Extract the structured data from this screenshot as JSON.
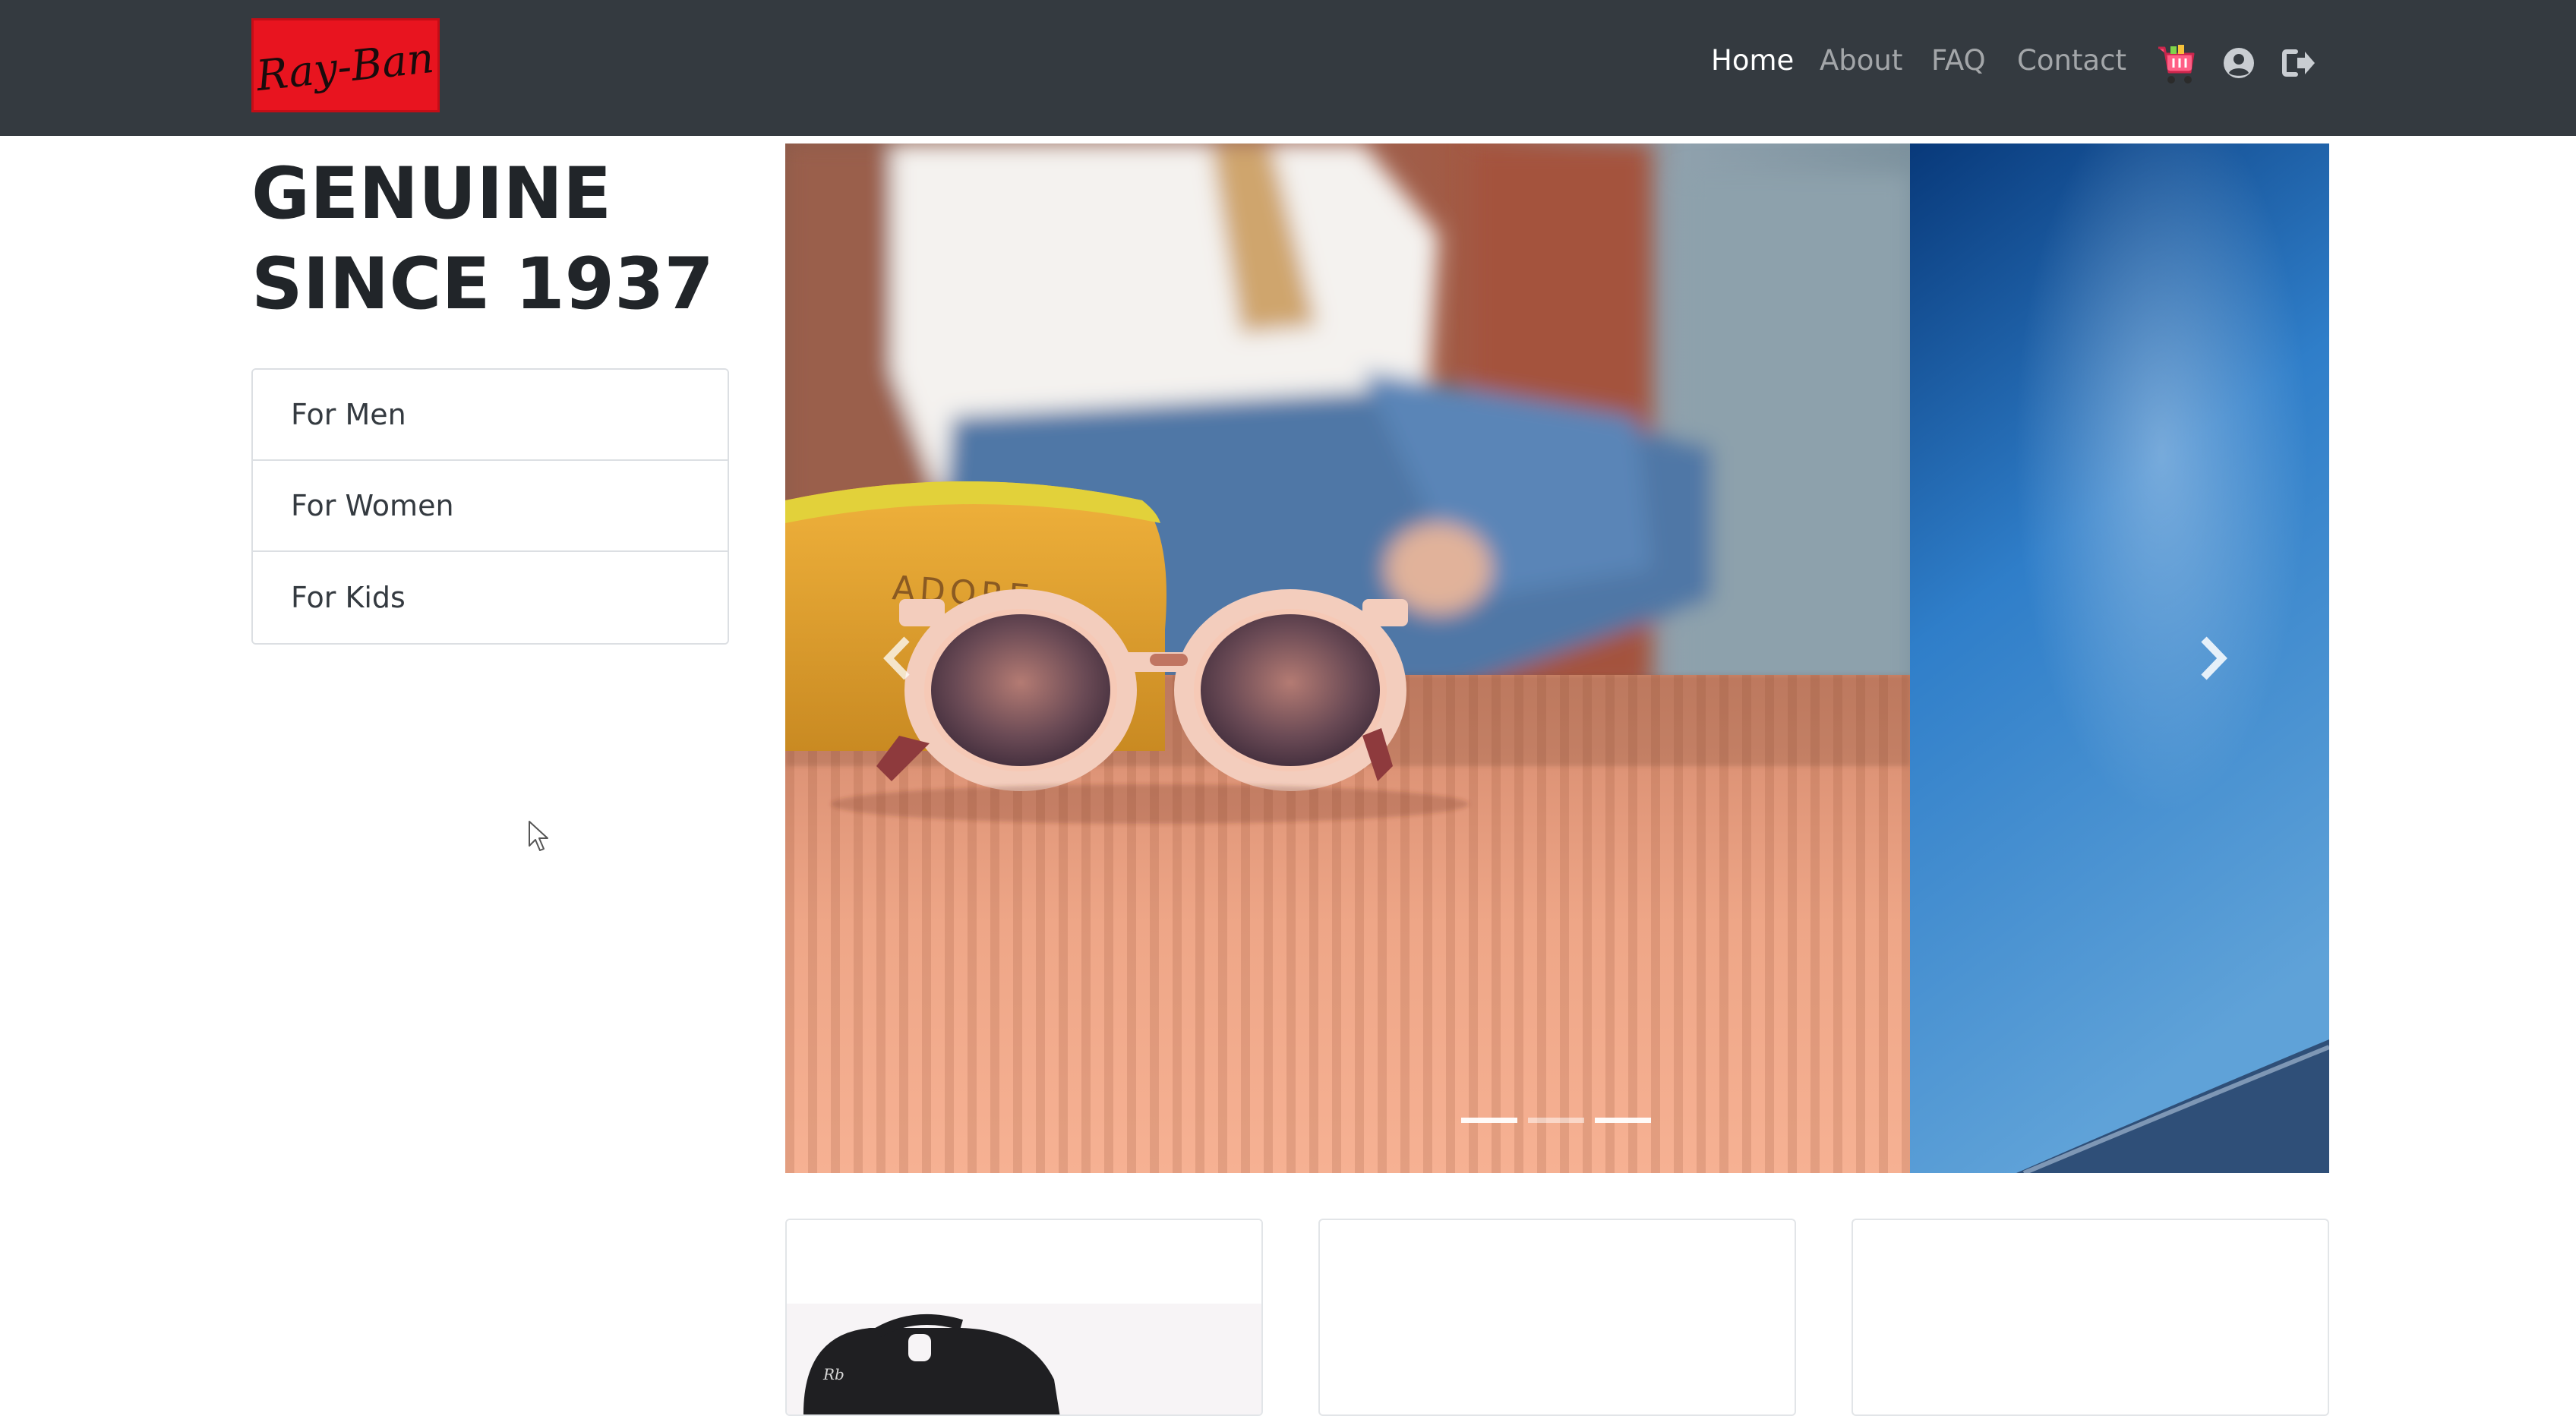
{
  "navbar": {
    "brand": "Ray-Ban",
    "links": [
      {
        "label": "Home",
        "active": true
      },
      {
        "label": "About",
        "active": false
      },
      {
        "label": "FAQ",
        "active": false
      },
      {
        "label": "Contact",
        "active": false
      }
    ],
    "icons": [
      "cart-icon",
      "user-circle-icon",
      "sign-out-icon"
    ]
  },
  "hero": {
    "tagline_line1": "GENUINE",
    "tagline_line2": "SINCE 1937"
  },
  "categories": [
    {
      "label": "For Men"
    },
    {
      "label": "For Women"
    },
    {
      "label": "For Kids"
    }
  ],
  "carousel": {
    "case_text": "ADORE",
    "slide_count": 3,
    "active_slide": 1
  },
  "products": [
    {
      "image": "sunglasses-aviator"
    },
    {
      "image": ""
    },
    {
      "image": ""
    }
  ],
  "colors": {
    "navbar_bg": "#343a40",
    "brand_red": "#e8141f",
    "nav_active": "#ffffff",
    "nav_inactive": "rgba(255,255,255,0.55)",
    "text_dark": "#212529"
  }
}
